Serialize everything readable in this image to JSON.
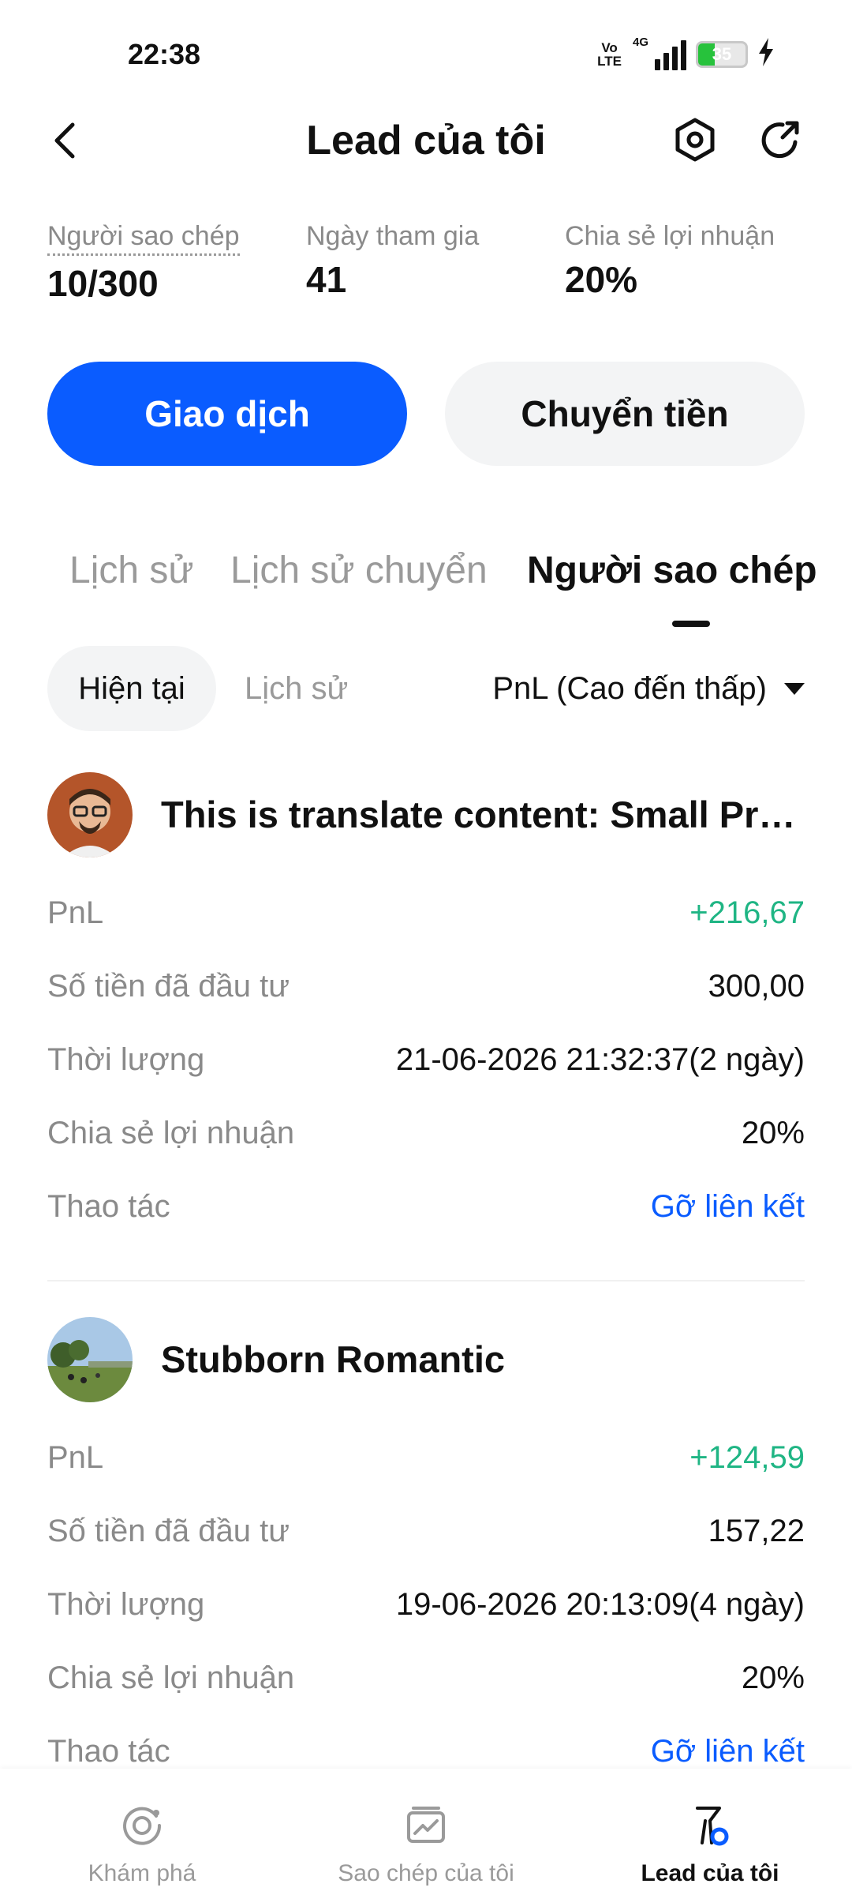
{
  "status_bar": {
    "time": "22:38",
    "volte_top": "Vo",
    "volte_bottom": "LTE",
    "network": "4G",
    "battery": "35",
    "battery_level": 0.35
  },
  "header": {
    "title": "Lead của tôi"
  },
  "stats": [
    {
      "label": "Người sao chép",
      "value": "10/300"
    },
    {
      "label": "Ngày tham gia",
      "value": "41"
    },
    {
      "label": "Chia sẻ lợi nhuận",
      "value": "20%"
    }
  ],
  "actions": {
    "primary": "Giao dịch",
    "secondary": "Chuyển tiền"
  },
  "tabs": [
    "Lịch sử",
    "Lịch sử chuyển",
    "Người sao chép"
  ],
  "sub_tabs": [
    "Hiện tại",
    "Lịch sử"
  ],
  "sort": {
    "label": "PnL (Cao đến thấp)"
  },
  "copiers": [
    {
      "name": "This is translate content: Small Profits Steady",
      "rows": [
        {
          "label": "PnL",
          "value": "+216,67"
        },
        {
          "label": "Số tiền đã đầu tư",
          "value": "300,00"
        },
        {
          "label": "Thời lượng",
          "value": "21-06-2026 21:32:37(2 ngày)"
        },
        {
          "label": "Chia sẻ lợi nhuận",
          "value": "20%"
        },
        {
          "label": "Thao tác",
          "value": "Gỡ liên kết"
        }
      ]
    },
    {
      "name": "Stubborn Romantic",
      "rows": [
        {
          "label": "PnL",
          "value": "+124,59"
        },
        {
          "label": "Số tiền đã đầu tư",
          "value": "157,22"
        },
        {
          "label": "Thời lượng",
          "value": "19-06-2026 20:13:09(4 ngày)"
        },
        {
          "label": "Chia sẻ lợi nhuận",
          "value": "20%"
        },
        {
          "label": "Thao tác",
          "value": "Gỡ liên kết"
        }
      ]
    }
  ],
  "bottom_nav": [
    {
      "label": "Khám phá",
      "icon": "explore-icon"
    },
    {
      "label": "Sao chép của tôi",
      "icon": "chart-icon"
    },
    {
      "label": "Lead của tôi",
      "icon": "lead-icon"
    }
  ],
  "colors": {
    "accent": "#0a5cff",
    "profit": "#1fb584",
    "muted": "#8a8a8a"
  }
}
